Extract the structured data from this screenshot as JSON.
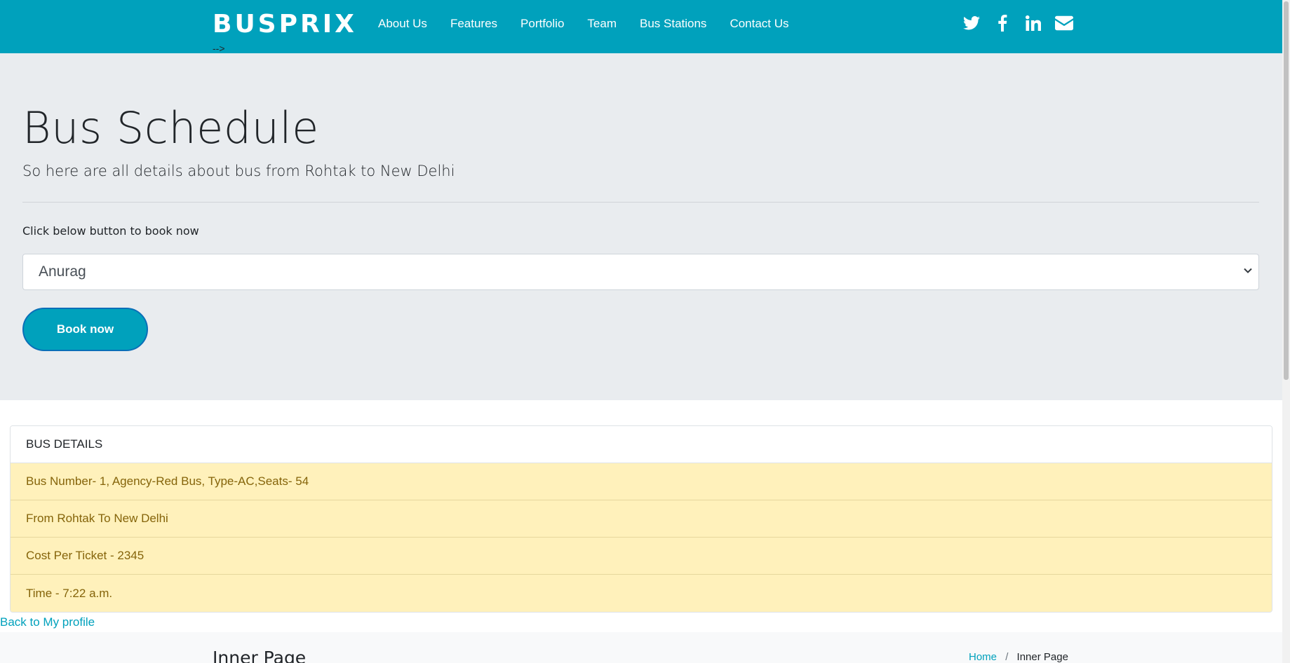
{
  "header": {
    "brand": "BUSPRIX",
    "stray_text": "-->",
    "nav": [
      "About Us",
      "Features",
      "Portfolio",
      "Team",
      "Bus Stations",
      "Contact Us"
    ],
    "social_icons": [
      "twitter-icon",
      "facebook-icon",
      "linkedin-icon",
      "envelope-icon"
    ],
    "accent_color": "#00a1bc"
  },
  "jumbotron": {
    "title": "Bus Schedule",
    "lead": "So here are all details about bus from Rohtak to New Delhi",
    "hint": "Click below button to book now",
    "select_value": "Anurag",
    "book_button": "Book now"
  },
  "bus_details": {
    "heading": "BUS DETAILS",
    "rows": [
      "Bus Number- 1, Agency-Red Bus, Type-AC,Seats- 54",
      "From Rohtak To New Delhi",
      "Cost Per Ticket - 2345",
      "Time - 7:22 a.m."
    ],
    "row_color": "#fff1bb"
  },
  "back_link": "Back to My profile",
  "breadcrumbs": {
    "title": "Inner Page",
    "home": "Home",
    "separator": "/",
    "current": "Inner Page"
  }
}
